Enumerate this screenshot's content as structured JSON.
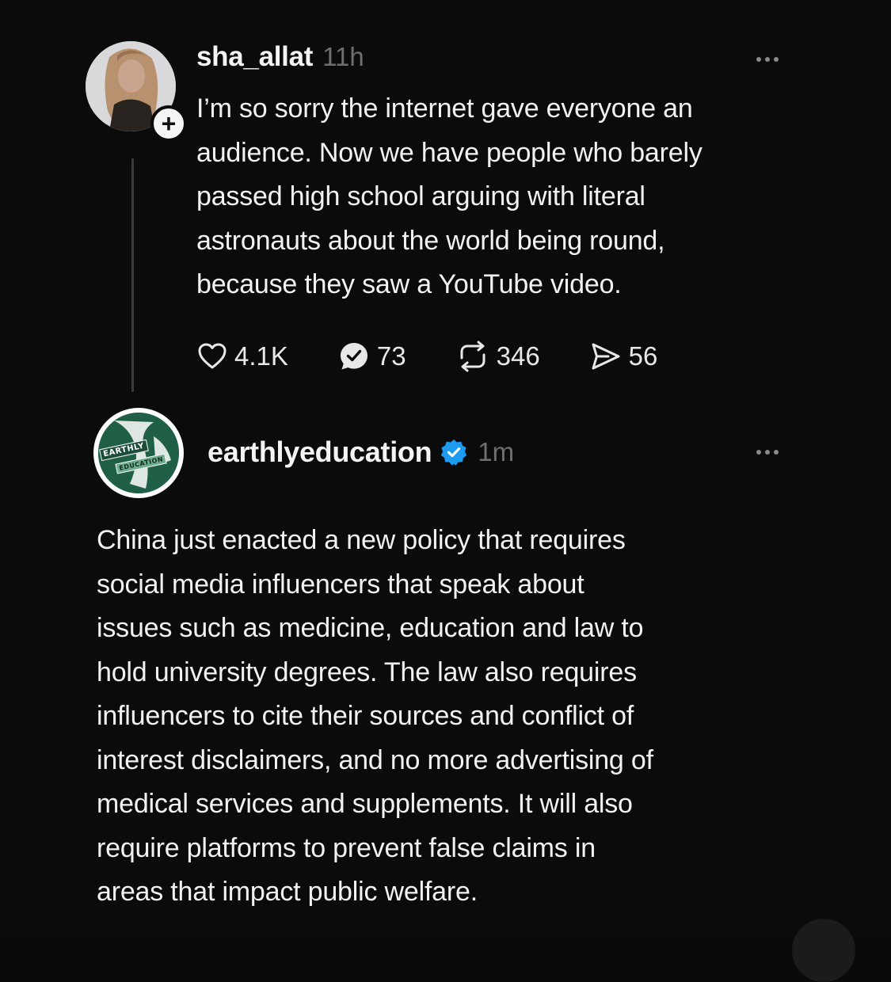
{
  "post1": {
    "username": "sha_allat",
    "timestamp": "11h",
    "text": "I’m so sorry the internet gave everyone an\naudience. Now we have people who barely\npassed high school arguing with literal\nastronauts about the world being round,\nbecause they saw a YouTube video.",
    "follow_symbol": "+",
    "stats": {
      "likes": "4.1K",
      "replies": "73",
      "reposts": "346",
      "shares": "56"
    },
    "icons": {
      "like": "heart-icon",
      "reply": "comment-check-icon",
      "repost": "repost-icon",
      "share": "send-icon",
      "more": "more-options-icon"
    }
  },
  "post2": {
    "username": "earthlyeducation",
    "timestamp": "1m",
    "verified": true,
    "avatar_badge_line1": "EARTHLY",
    "avatar_badge_line2": "EDUCATION",
    "text": "China just enacted a new policy that requires\nsocial media influencers that speak about\nissues such as medicine, education and law to\nhold university degrees. The law also requires\ninfluencers to cite their sources and conflict of\ninterest disclaimers, and no more advertising of\nmedical services and supplements. It will also\nrequire platforms to prevent false claims in\nareas that impact public welfare."
  },
  "colors": {
    "background": "#0b0b0b",
    "text": "#f2f2f2",
    "muted": "#6f6f6f",
    "verified": "#1d9bf0",
    "thread_line": "#3a3a3a"
  }
}
